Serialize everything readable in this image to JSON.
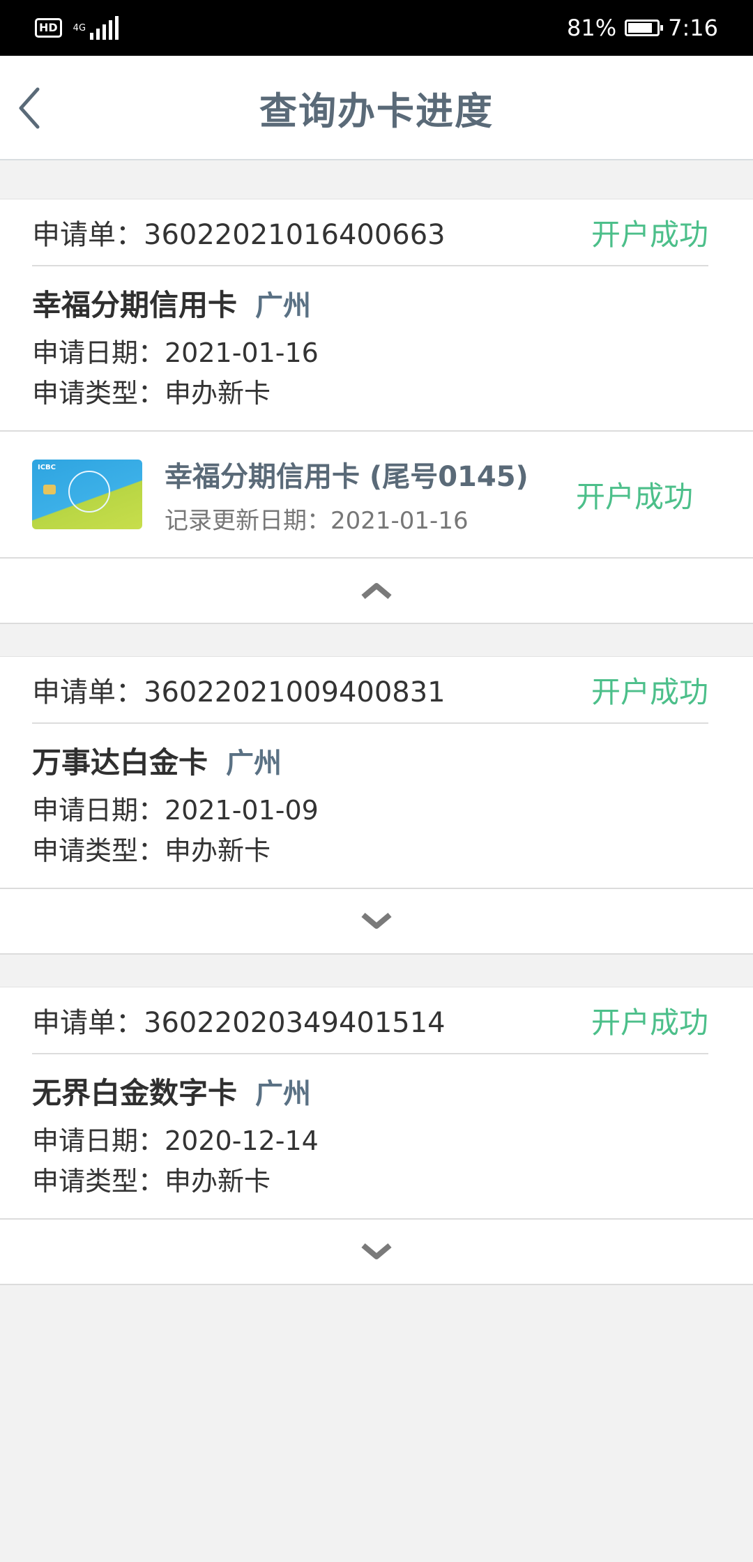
{
  "status_bar": {
    "hd": "HD",
    "network": "4G",
    "battery": "81%",
    "time": "7:16"
  },
  "nav": {
    "back_icon": "chevron-left-icon",
    "title": "查询办卡进度"
  },
  "applications": [
    {
      "number_label": "申请单：3602202101640066 3",
      "number": "申请单：36022021016400663",
      "status": "开户成功",
      "card_name": "幸福分期信用卡",
      "city": "广州",
      "date_line": "申请日期：2021-01-16",
      "type_line": "申请类型：申办新卡",
      "detail": {
        "title": "幸福分期信用卡 (尾号0145)",
        "update_line": "记录更新日期：2021-01-16",
        "status": "开户成功"
      },
      "toggle_icon": "chevron-up-icon"
    },
    {
      "number": "申请单：36022021009400831",
      "status": "开户成功",
      "card_name": "万事达白金卡",
      "city": "广州",
      "date_line": "申请日期：2021-01-09",
      "type_line": "申请类型：申办新卡",
      "toggle_icon": "chevron-down-icon"
    },
    {
      "number": "申请单：36022020349401514",
      "status": "开户成功",
      "card_name": "无界白金数字卡",
      "city": "广州",
      "date_line": "申请日期：2020-12-14",
      "type_line": "申请类型：申办新卡",
      "toggle_icon": "chevron-down-icon"
    }
  ],
  "colors": {
    "status_green": "#4cbf8a",
    "title_gray": "#5a6a78",
    "background": "#f2f2f2"
  }
}
